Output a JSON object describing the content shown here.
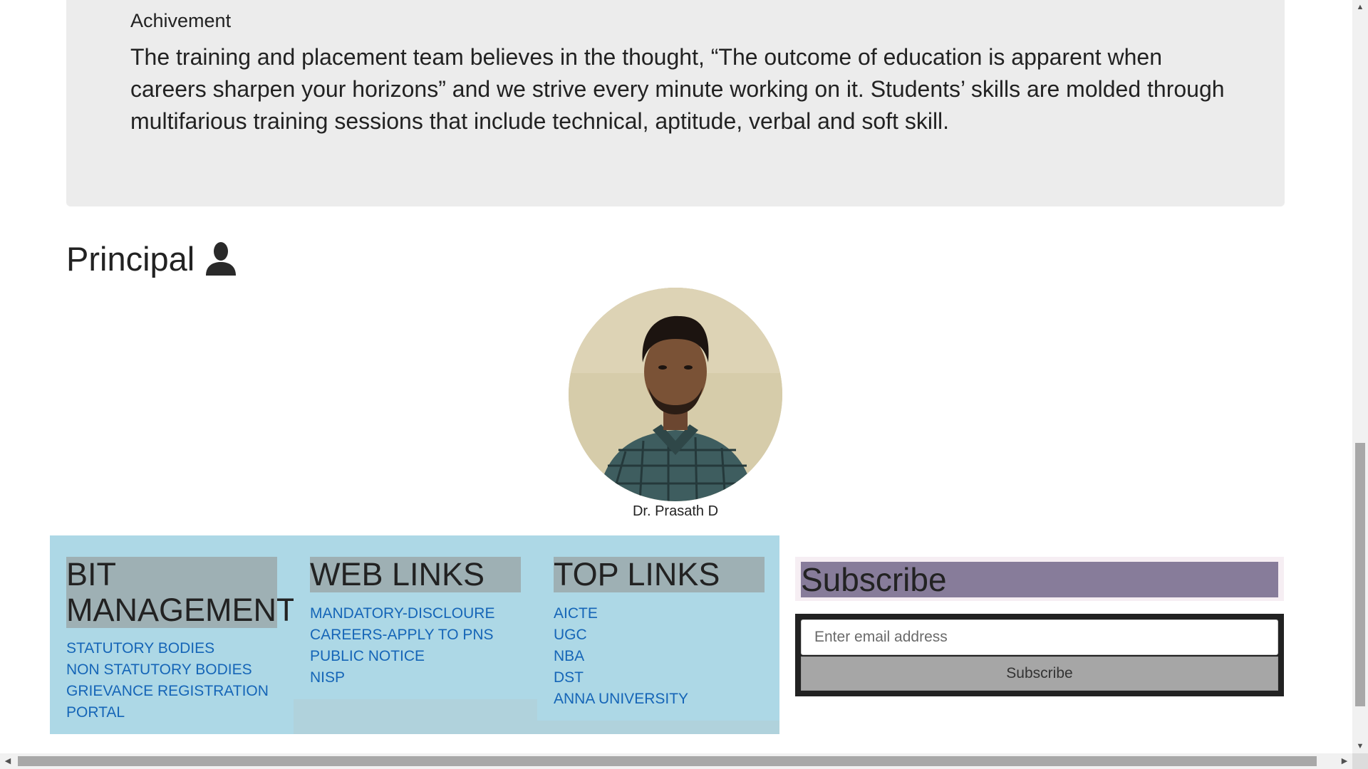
{
  "achievement": {
    "title": "Achivement",
    "text": "The training and placement team believes in the thought, “The outcome of education is apparent when careers sharpen your horizons” and we strive every minute working on it. Students’ skills are molded through multifarious training sessions that include technical, aptitude, verbal and soft skill."
  },
  "principal": {
    "heading": "Principal",
    "icon": "person-icon",
    "name": "Dr. Prasath D"
  },
  "footer_links": {
    "columns": [
      {
        "heading_lines": [
          "BIT",
          "MANAGEMENT"
        ],
        "links": [
          "STATUTORY BODIES",
          "NON STATUTORY BODIES",
          "GRIEVANCE REGISTRATION PORTAL"
        ]
      },
      {
        "heading_lines": [
          "WEB LINKS"
        ],
        "links": [
          "MANDATORY-DISCLOURE",
          "CAREERS-APPLY TO PNS",
          "PUBLIC NOTICE",
          "NISP"
        ]
      },
      {
        "heading_lines": [
          "TOP LINKS"
        ],
        "links": [
          "AICTE",
          "UGC",
          "NBA",
          "DST",
          "ANNA UNIVERSITY"
        ]
      }
    ]
  },
  "subscribe": {
    "title": "Subscribe",
    "email_placeholder": "Enter email address",
    "email_value": "",
    "button_label": "Subscribe"
  },
  "scrollbars": {
    "up_arrow": "▲",
    "down_arrow": "▼",
    "left_arrow": "◀",
    "right_arrow": "▶"
  },
  "colors": {
    "card_bg": "#ececec",
    "links_panel_bg": "#add8e6",
    "heading_bg": "#9eb0b4",
    "link_color": "#1565b7",
    "subscribe_title_bg": "#877c9a",
    "subscribe_btn_bg": "#a6a6a6"
  }
}
